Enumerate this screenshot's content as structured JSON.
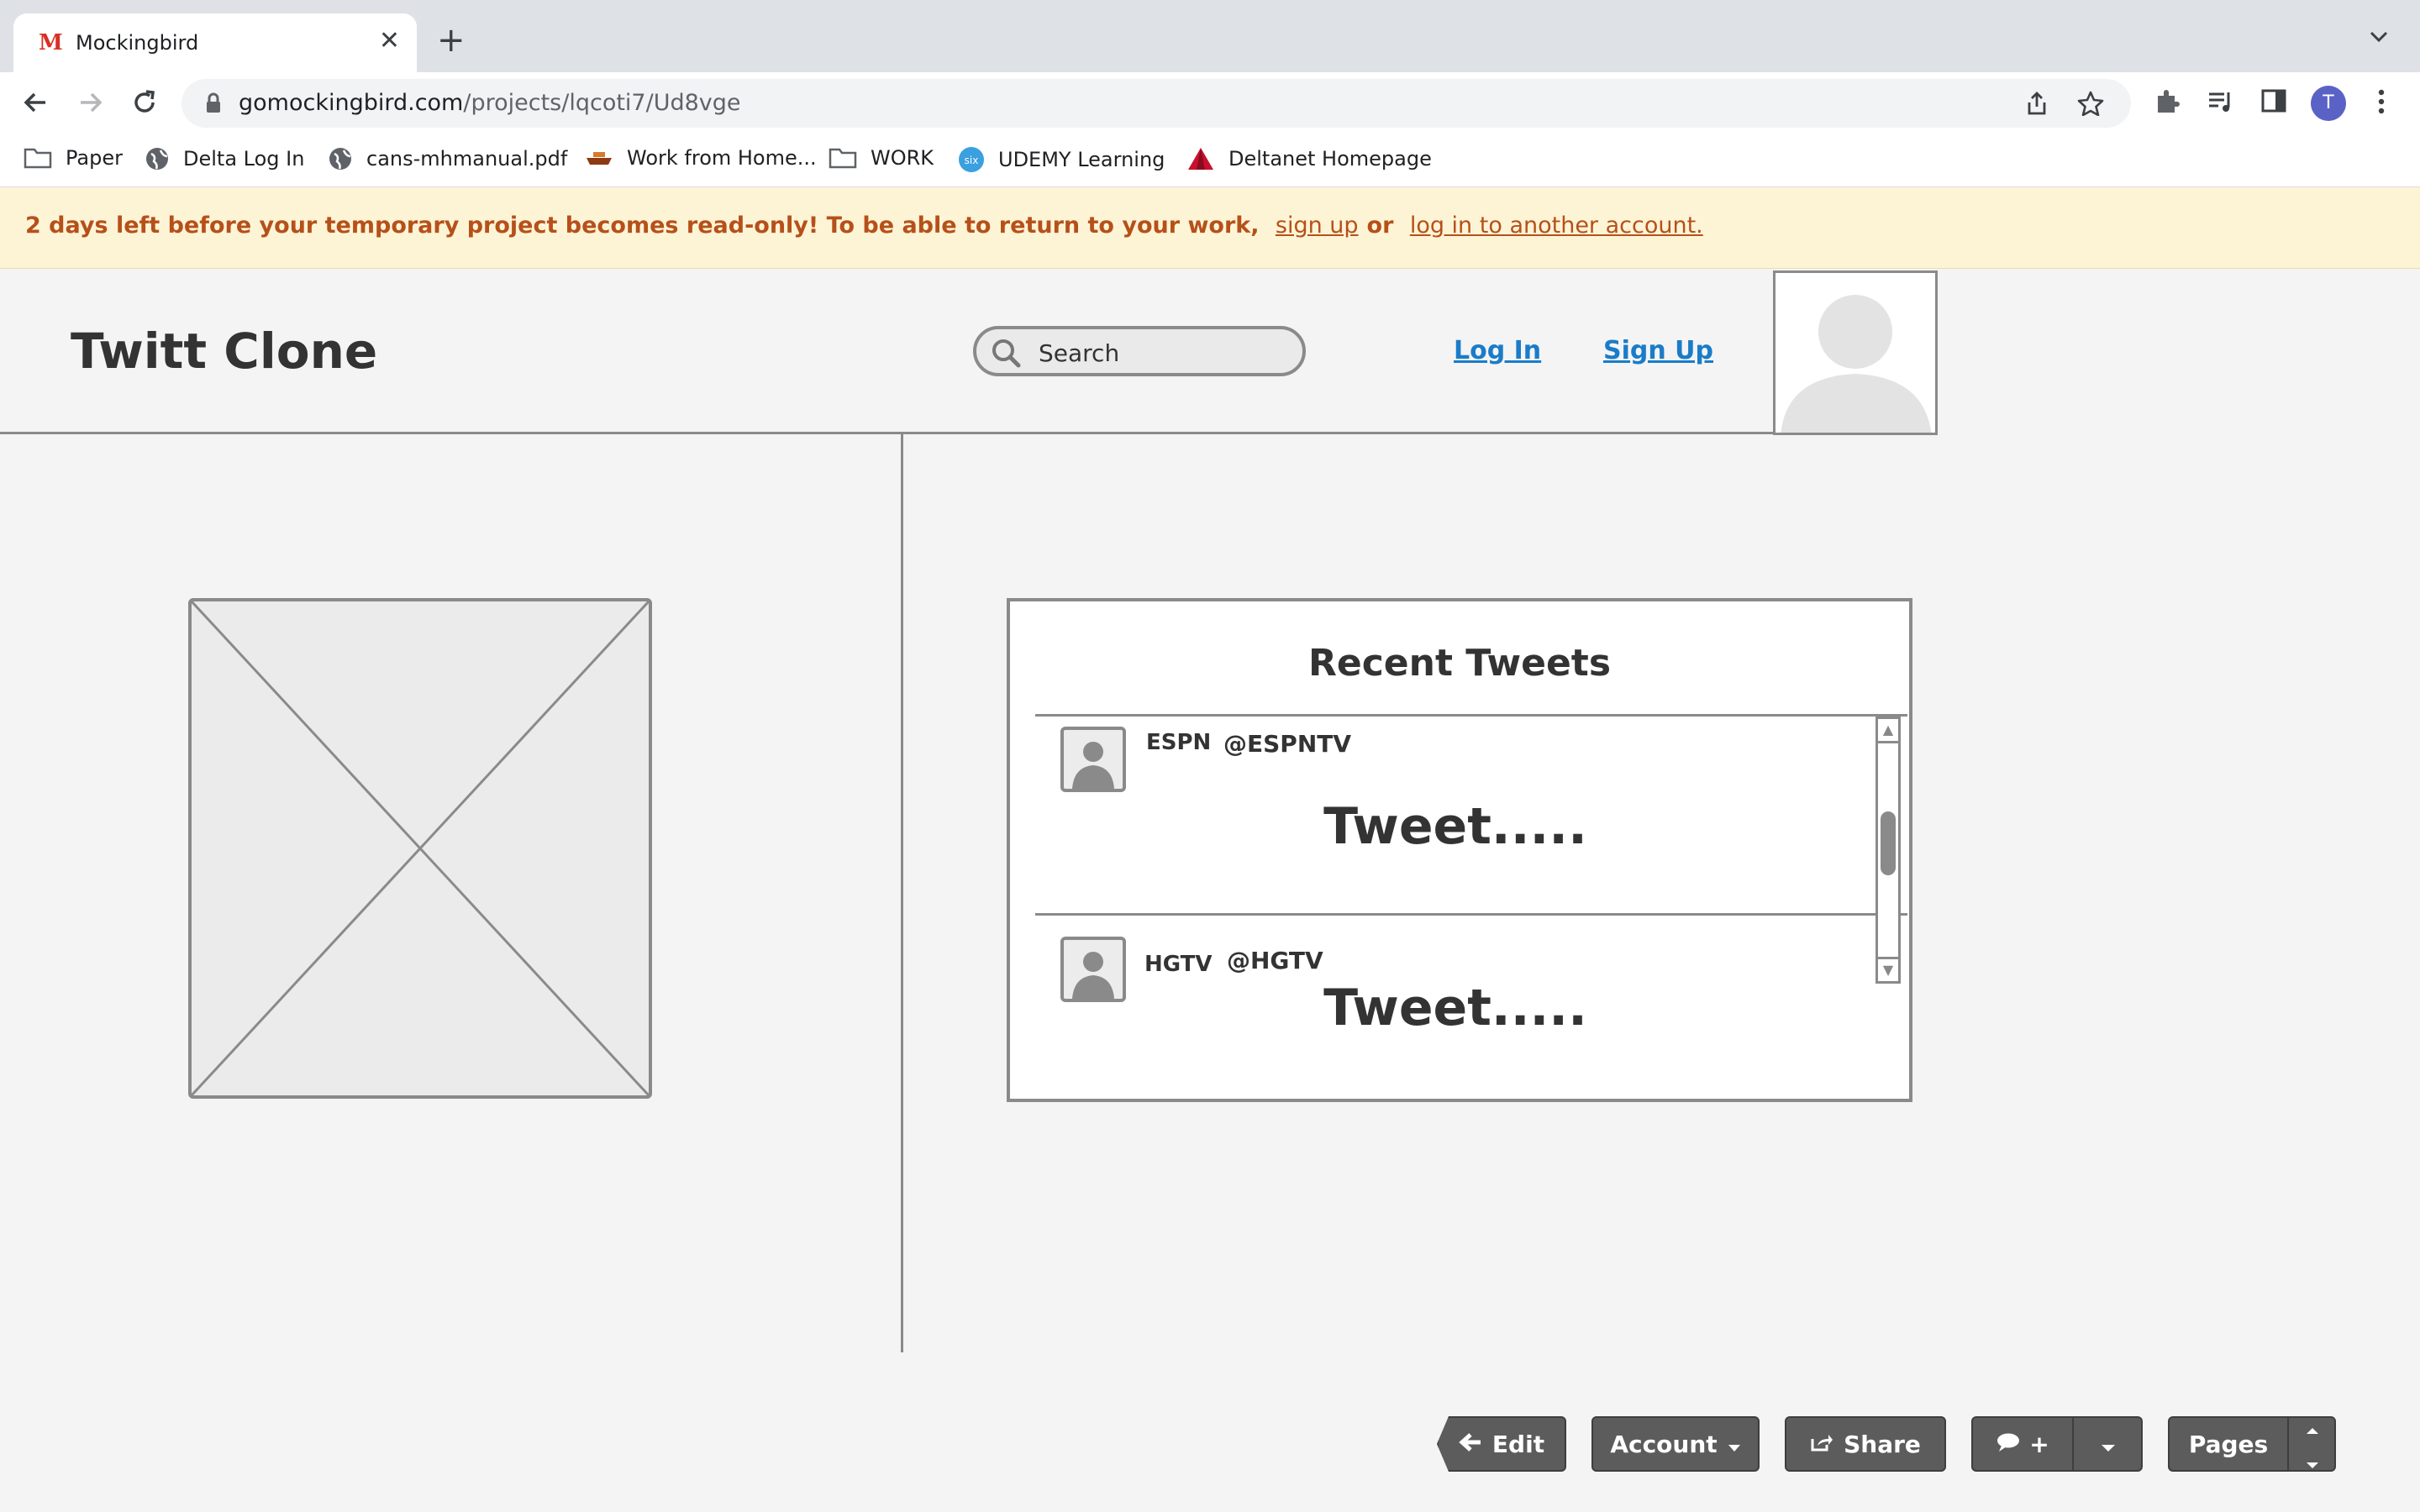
{
  "browser": {
    "tab": {
      "title": "Mockingbird",
      "favicon": "M"
    },
    "address": {
      "domain": "gomockingbird.com",
      "path": "/projects/lqcoti7/Ud8vge"
    },
    "profile_initial": "T",
    "bookmarks": [
      {
        "label": "Paper",
        "icon": "folder-icon"
      },
      {
        "label": "Delta Log In",
        "icon": "globe-icon"
      },
      {
        "label": "cans-mhmanual.pdf",
        "icon": "globe-icon"
      },
      {
        "label": "Work from Home...",
        "icon": "boat-icon"
      },
      {
        "label": "WORK",
        "icon": "folder-icon"
      },
      {
        "label": "UDEMY Learning",
        "icon": "udemy-icon"
      },
      {
        "label": "Deltanet Homepage",
        "icon": "delta-logo-icon"
      }
    ]
  },
  "banner": {
    "message": "2 days left before your temporary project becomes read-only! To be able to return to your work,",
    "signup_link": "sign up",
    "or": "or",
    "login_link": "log in to another account.",
    "text_color": "#b6501a",
    "bg_color": "#fdf4d6"
  },
  "mockup": {
    "title": "Twitt Clone",
    "search_placeholder": "Search",
    "login_link": "Log In",
    "signup_link": "Sign Up",
    "link_color": "#1a7cc9",
    "recent_tweets": {
      "title": "Recent Tweets",
      "tweets": [
        {
          "name": "ESPN",
          "handle": "@ESPNTV",
          "body": "Tweet....."
        },
        {
          "name": "HGTV",
          "handle": "@HGTV",
          "body": "Tweet....."
        }
      ]
    }
  },
  "footer_toolbar": {
    "edit": "Edit",
    "account": "Account",
    "share": "Share",
    "comment_add": "+",
    "pages": "Pages"
  }
}
